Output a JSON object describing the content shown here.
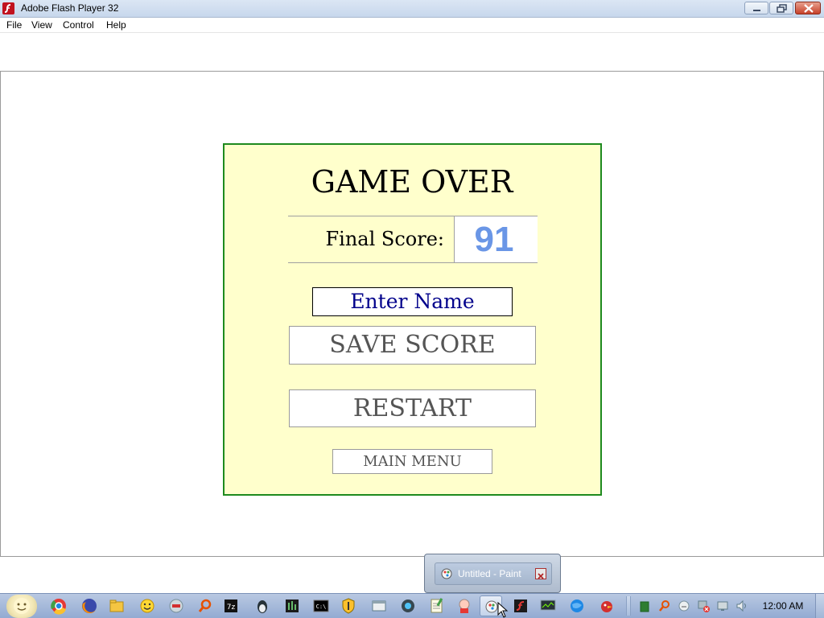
{
  "window": {
    "title": "Adobe Flash Player 32",
    "icon": "flash-player-icon",
    "buttons": [
      "minimize",
      "restore",
      "close"
    ]
  },
  "menu": {
    "items": [
      "File",
      "View",
      "Control",
      "Help"
    ]
  },
  "game": {
    "title": "GAME OVER",
    "score_label": "Final Score:",
    "score_value": "91",
    "name_placeholder": "Enter Name",
    "save_label": "SAVE SCORE",
    "restart_label": "RESTART",
    "main_menu_label": "MAIN MENU"
  },
  "taskbar_popup": {
    "label": "Untitled - Paint",
    "icon": "paint-icon"
  },
  "taskbar": {
    "clock": "12:00 AM"
  },
  "colors": {
    "panel_bg": "#ffffcc",
    "panel_border": "#1e8a1e",
    "score_color": "#6a96e6",
    "name_text": "#00008b"
  }
}
